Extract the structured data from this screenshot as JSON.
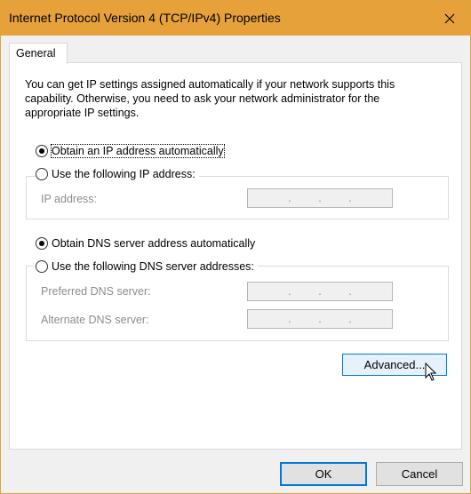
{
  "window": {
    "title": "Internet Protocol Version 4 (TCP/IPv4) Properties"
  },
  "tabs": [
    {
      "label": "General"
    }
  ],
  "description": "You can get IP settings assigned automatically if your network supports this capability. Otherwise, you need to ask your network administrator for the appropriate IP settings.",
  "ip": {
    "auto_label": "Obtain an IP address automatically",
    "manual_label": "Use the following IP address:",
    "selected": "auto",
    "ip_address_label": "IP address:",
    "ip_address_value": ""
  },
  "dns": {
    "auto_label": "Obtain DNS server address automatically",
    "manual_label": "Use the following DNS server addresses:",
    "selected": "auto",
    "preferred_label": "Preferred DNS server:",
    "alternate_label": "Alternate DNS server:"
  },
  "ip_dots": ".",
  "buttons": {
    "advanced": "Advanced...",
    "ok": "OK",
    "cancel": "Cancel"
  },
  "colors": {
    "titlebar": "#e6a13a",
    "accent": "#0078d7"
  }
}
